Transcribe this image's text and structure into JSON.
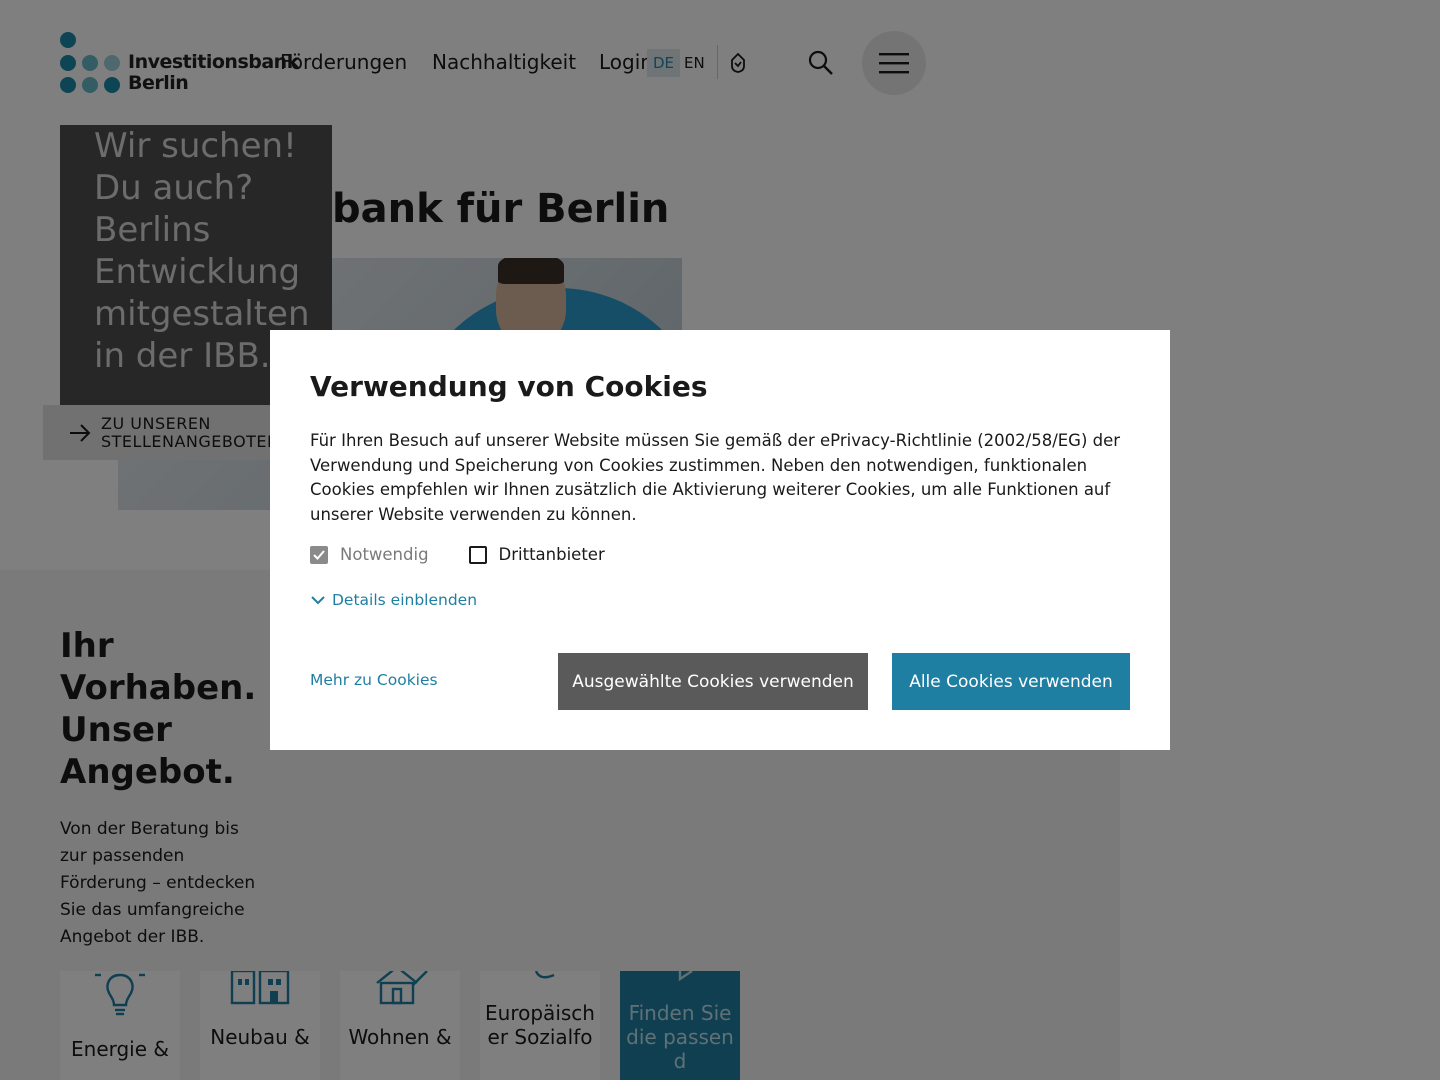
{
  "header": {
    "logo_line1": "Investitionsbank",
    "logo_line2": "Berlin",
    "nav": [
      "Förderungen",
      "Nachhaltigkeit",
      "Login"
    ],
    "lang_de": "DE",
    "lang_en": "EN"
  },
  "hero": {
    "title_visible": "bank für Berlin"
  },
  "job_teaser": {
    "headline": "Wir suchen! Du auch? Berlins Entwicklung mitgestalten in der IBB.",
    "link_line1": "ZU UNSEREN",
    "link_line2": "STELLENANGEBOTEN"
  },
  "offer": {
    "title": "Ihr Vorhaben. Unser Angebot.",
    "text": "Von der Beratung bis zur passenden Förderung – entdecken Sie das umfangreiche Angebot der IBB.",
    "tiles": [
      {
        "label": "Energie &",
        "icon": "lightbulb-icon"
      },
      {
        "label": "Neubau &",
        "icon": "buildings-icon"
      },
      {
        "label": "Wohnen &",
        "icon": "house-icon"
      },
      {
        "label": "Europäischer Sozialfo",
        "icon": "chat-icon"
      },
      {
        "label": "Finden Sie die passend",
        "icon": "arrow-icon"
      }
    ]
  },
  "cookie_dialog": {
    "title": "Verwendung von Cookies",
    "text": "Für Ihren Besuch auf unserer Website müssen Sie gemäß der ePrivacy-Richtlinie (2002/58/EG) der Verwendung und Speicherung von Cookies zustimmen. Neben den notwendigen, funktionalen Cookies empfehlen wir Ihnen zusätzlich die Aktivierung weiterer Cookies, um alle Funktionen auf unserer Website verwenden zu können.",
    "checkbox_necessary": "Notwendig",
    "checkbox_third_party": "Drittanbieter",
    "details_link": "Details einblenden",
    "more_link": "Mehr zu Cookies",
    "btn_selected": "Ausgewählte Cookies verwenden",
    "btn_all": "Alle Cookies verwenden"
  },
  "colors": {
    "accent": "#1f7fa3",
    "logo_dark": "#1d8aa8",
    "logo_light": "#69b8cb"
  }
}
